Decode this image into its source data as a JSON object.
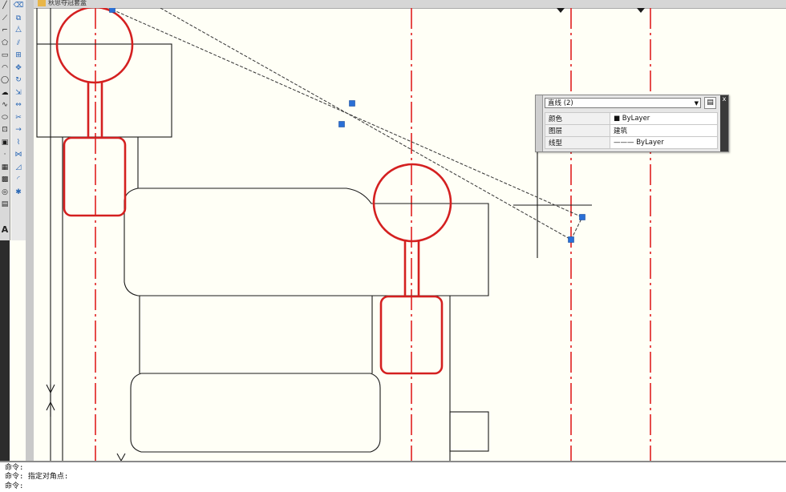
{
  "document": {
    "tab_title": "秋思夺冠套盒"
  },
  "toolbar": {
    "draw_tools": [
      "line",
      "xline",
      "polyline",
      "polygon",
      "rectangle",
      "arc",
      "circle",
      "revcloud",
      "spline",
      "ellipse",
      "insert",
      "block",
      "point",
      "hatch",
      "gradient",
      "region",
      "table",
      "mtext"
    ],
    "modify_tools": [
      "erase",
      "copy",
      "mirror",
      "offset",
      "array",
      "move",
      "rotate",
      "scale",
      "stretch",
      "trim",
      "extend",
      "break",
      "join",
      "chamfer",
      "fillet",
      "explode"
    ],
    "text_tool_label": "A"
  },
  "properties_palette": {
    "selection": "直线 (2)",
    "rows": [
      {
        "label": "颜色",
        "value": "■ ByLayer"
      },
      {
        "label": "图层",
        "value": "建筑"
      },
      {
        "label": "线型",
        "value": "——— ByLayer"
      }
    ],
    "close_label": "x"
  },
  "command_line": {
    "lines": [
      "命令:",
      "命令: 指定对角点:",
      "命令:"
    ]
  },
  "colors": {
    "canvas_bg": "#fffff6",
    "axis_red": "#e02020",
    "column_red": "#d42020",
    "grip_blue": "#2a6fd6",
    "outline": "#1a1a1a"
  }
}
